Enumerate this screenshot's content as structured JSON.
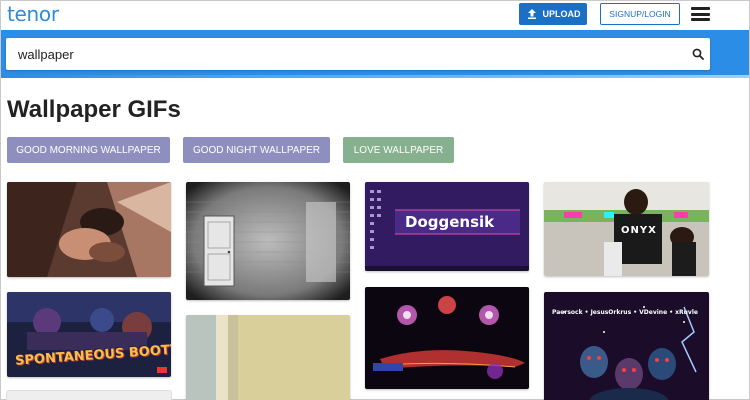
{
  "header": {
    "logo": "tenor",
    "upload_label": "UPLOAD",
    "signup_label": "SIGNUP/LOGIN"
  },
  "search": {
    "value": "wallpaper"
  },
  "page": {
    "title": "Wallpaper GIFs"
  },
  "tags": [
    {
      "label": "GOOD MORNING WALLPAPER",
      "color": "#8f8fbf"
    },
    {
      "label": "GOOD NIGHT WALLPAPER",
      "color": "#8f8fbf"
    },
    {
      "label": "LOVE WALLPAPER",
      "color": "#86b08e"
    }
  ],
  "gifs": {
    "doggensik_text": "Doggensik",
    "onyx_text": "ONYX",
    "spontaneous_text": "SPONTANEOUS BOOTY",
    "names_text": "Paersock • JesusOrkrus • VDevine • xRuvle"
  },
  "colors": {
    "brand_blue": "#2b8de5",
    "button_blue": "#1b6fc4"
  }
}
